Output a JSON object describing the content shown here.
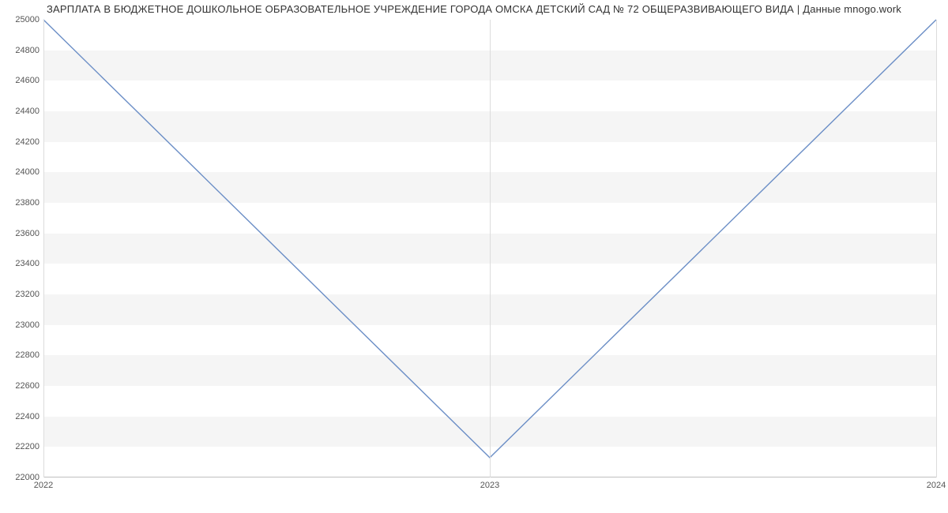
{
  "chart_data": {
    "type": "line",
    "title": "ЗАРПЛАТА В БЮДЖЕТНОЕ ДОШКОЛЬНОЕ ОБРАЗОВАТЕЛЬНОЕ УЧРЕЖДЕНИЕ ГОРОДА ОМСКА ДЕТСКИЙ САД № 72 ОБЩЕРАЗВИВАЮЩЕГО ВИДА | Данные mnogo.work",
    "x": [
      "2022",
      "2023",
      "2024"
    ],
    "values": [
      25000,
      22130,
      25000
    ],
    "xlabel": "",
    "ylabel": "",
    "ylim": [
      22000,
      25000
    ],
    "y_ticks": [
      22000,
      22200,
      22400,
      22600,
      22800,
      23000,
      23200,
      23400,
      23600,
      23800,
      24000,
      24200,
      24400,
      24600,
      24800,
      25000
    ],
    "line_color": "#6b8ec6",
    "band_color": "#f5f5f5"
  }
}
